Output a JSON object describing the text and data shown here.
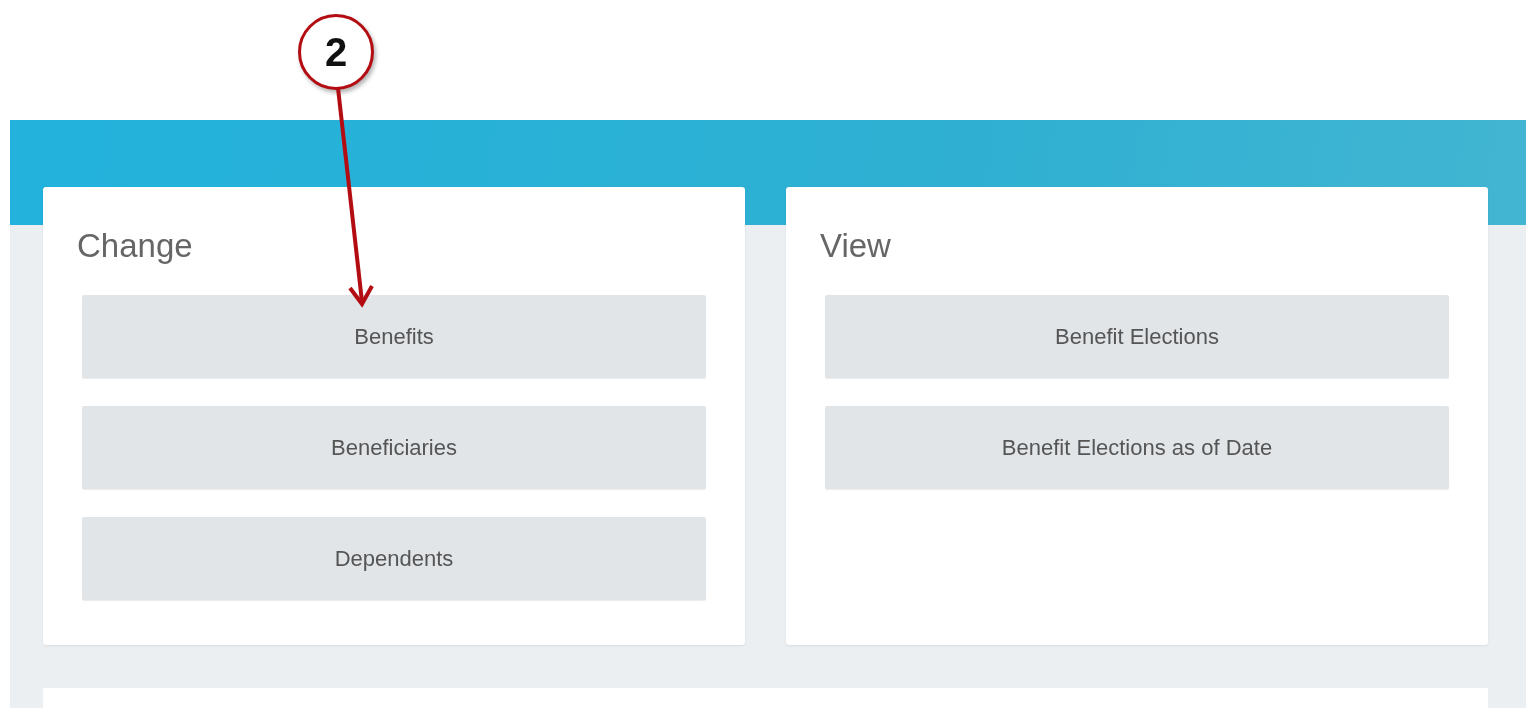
{
  "callout": {
    "label": "2"
  },
  "panels": [
    {
      "title": "Change",
      "buttons": [
        "Benefits",
        "Beneficiaries",
        "Dependents"
      ]
    },
    {
      "title": "View",
      "buttons": [
        "Benefit Elections",
        "Benefit Elections as of Date"
      ]
    }
  ]
}
